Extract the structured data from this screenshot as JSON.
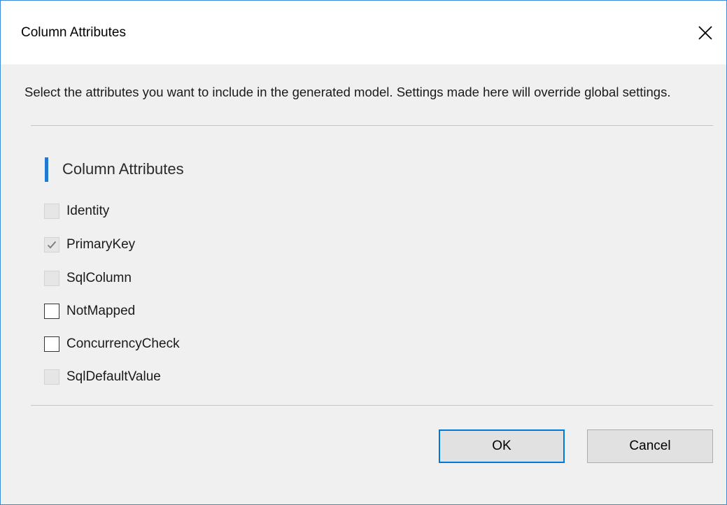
{
  "window": {
    "title": "Column Attributes"
  },
  "description": "Select the attributes you want to include in the generated model. Settings made here will override global settings.",
  "section": {
    "title": "Column Attributes"
  },
  "options": [
    {
      "label": "Identity",
      "checked": false,
      "enabled": false
    },
    {
      "label": "PrimaryKey",
      "checked": true,
      "enabled": false
    },
    {
      "label": "SqlColumn",
      "checked": false,
      "enabled": false
    },
    {
      "label": "NotMapped",
      "checked": false,
      "enabled": true
    },
    {
      "label": "ConcurrencyCheck",
      "checked": false,
      "enabled": true
    },
    {
      "label": "SqlDefaultValue",
      "checked": false,
      "enabled": false
    }
  ],
  "buttons": {
    "ok": "OK",
    "cancel": "Cancel"
  },
  "icons": {
    "close": "close-icon",
    "check": "checkmark-icon"
  },
  "colors": {
    "accent": "#1f78d1",
    "border": "#3c8bd6",
    "primary_button_border": "#0078d7"
  }
}
